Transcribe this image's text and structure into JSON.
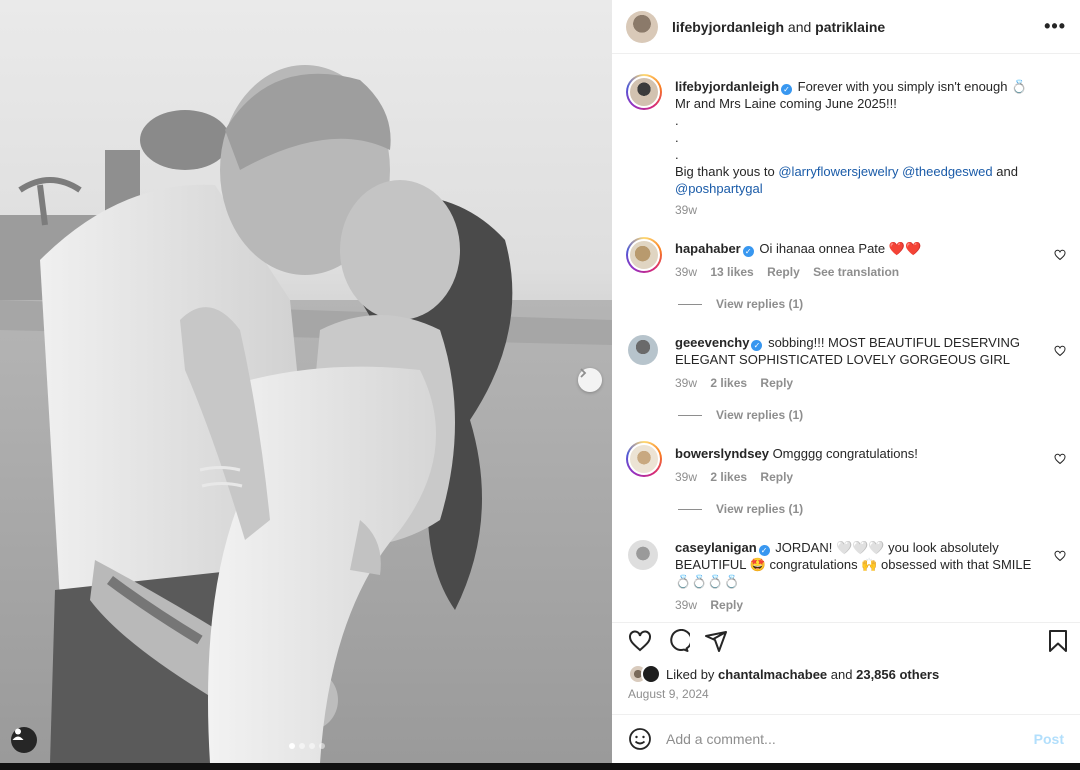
{
  "header": {
    "author": "lifebyjordanleigh",
    "and": "and",
    "coauthor": "patriklaine",
    "more_label": "•••"
  },
  "caption": {
    "user": "lifebyjordanleigh",
    "text1": "Forever with you simply isn't enough 💍 Mr and Mrs Laine coming June 2025!!!",
    "dots": ".",
    "thanks_prefix": "Big thank yous to",
    "mention1": "@larryflowersjewelry",
    "mention2": "@theedgeswed",
    "and": "and",
    "mention3": "@poshpartygal",
    "time": "39w"
  },
  "comments": [
    {
      "user": "hapahaber",
      "verified": true,
      "text": "Oi ihanaa onnea Pate ❤️❤️",
      "time": "39w",
      "likes": "13 likes",
      "reply": "Reply",
      "translate": "See translation",
      "replies": "View replies (1)"
    },
    {
      "user": "geeevenchy",
      "verified": true,
      "text": "sobbing!!! MOST BEAUTIFUL DESERVING ELEGANT SOPHISTICATED LOVELY GORGEOUS GIRL",
      "time": "39w",
      "likes": "2 likes",
      "reply": "Reply",
      "replies": "View replies (1)"
    },
    {
      "user": "bowerslyndsey",
      "verified": false,
      "text": "Omgggg congratulations!",
      "time": "39w",
      "likes": "2 likes",
      "reply": "Reply",
      "replies": "View replies (1)"
    },
    {
      "user": "caseylanigan",
      "verified": true,
      "text": "JORDAN! 🤍🤍🤍 you look absolutely BEAUTIFUL 🤩 congratulations 🙌 obsessed with that SMILE 💍💍💍💍",
      "time": "39w",
      "reply": "Reply"
    }
  ],
  "likes_line": {
    "prefix": "Liked by",
    "user": "chantalmachabee",
    "and": "and",
    "others": "23,856 others"
  },
  "date": "August 9, 2024",
  "add_comment": {
    "placeholder": "Add a comment...",
    "post": "Post"
  },
  "carousel": {
    "slides": 4,
    "active_index": 0
  },
  "colors": {
    "link": "#1a5ba8",
    "verified": "#3897f0",
    "like_heart": "#ed4956"
  }
}
